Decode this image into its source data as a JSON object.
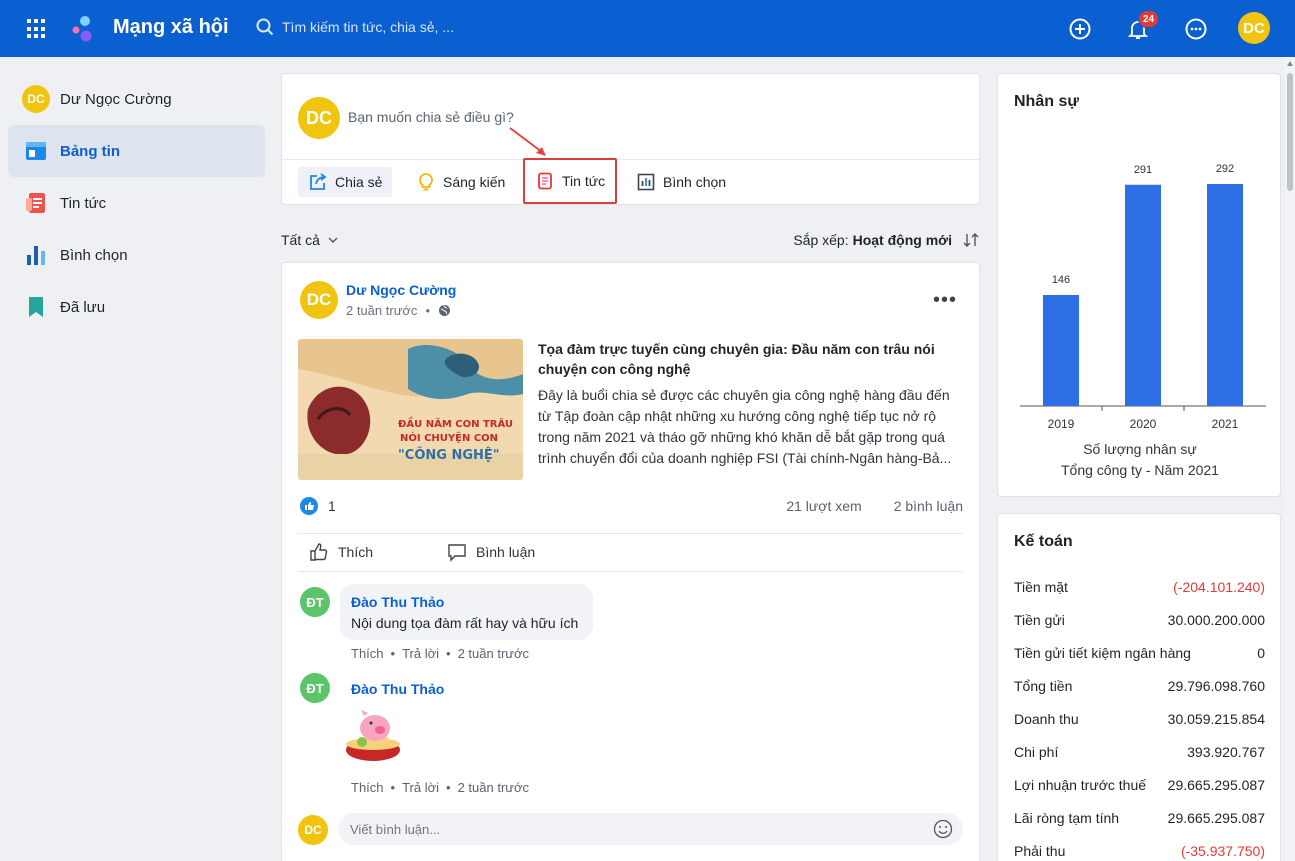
{
  "topbar": {
    "app_title": "Mạng xã hội",
    "search_placeholder": "Tìm kiếm tin tức, chia sẻ, ...",
    "notification_count": "24",
    "user_initials": "DC"
  },
  "sidebar": {
    "profile_name": "Dư Ngọc Cường",
    "profile_initials": "DC",
    "items": [
      {
        "label": "Bảng tin",
        "icon": "newsfeed-icon"
      },
      {
        "label": "Tin tức",
        "icon": "news-icon"
      },
      {
        "label": "Bình chọn",
        "icon": "poll-icon"
      },
      {
        "label": "Đã lưu",
        "icon": "bookmark-icon"
      }
    ]
  },
  "composer": {
    "initials": "DC",
    "prompt": "Bạn muốn chia sẻ điều gì?",
    "actions": [
      "Chia sẻ",
      "Sáng kiến",
      "Tin tức",
      "Bình chọn"
    ]
  },
  "feed_filter": {
    "filter_label": "Tất cả",
    "sort_label": "Sắp xếp:",
    "sort_value": "Hoạt động mới"
  },
  "post": {
    "author": "Dư Ngọc Cường",
    "author_initials": "DC",
    "time": "2 tuần trước",
    "news_title": "Tọa đàm trực tuyến cùng chuyên gia: Đầu năm con trâu nói chuyện con công nghệ",
    "news_desc": "Đây là buổi chia sẻ được các chuyên gia công nghệ hàng đầu đến từ Tập đoàn cập nhật những xu hướng công nghệ tiếp tục nở rộ trong năm 2021 và tháo gỡ những khó khăn dễ bắt gặp trong quá trình chuyển đổi của doanh nghiệp FSI (Tài chính-Ngân hàng-Bả...",
    "thumb_text_1": "ĐẦU NĂM CON TRÂU",
    "thumb_text_2": "NÓI CHUYỆN CON",
    "thumb_text_3": "\"CÔNG NGHỆ\"",
    "like_count": "1",
    "views": "21 lượt xem",
    "comments": "2 bình luận",
    "like_label": "Thích",
    "comment_label": "Bình luận",
    "comment_placeholder": "Viết bình luận...",
    "commenter_initials": "DC"
  },
  "comments": [
    {
      "initials": "ĐT",
      "name": "Đào Thu Thảo",
      "text": "Nội dung tọa đàm rất hay và hữu ích",
      "like": "Thích",
      "reply": "Trả lời",
      "time": "2 tuần trước"
    },
    {
      "initials": "ĐT",
      "name": "Đào Thu Thảo",
      "text": "",
      "like": "Thích",
      "reply": "Trả lời",
      "time": "2 tuần trước"
    }
  ],
  "hr_widget": {
    "title": "Nhân sự",
    "caption_line1": "Số lượng nhân sự",
    "caption_line2": "Tổng công ty - Năm 2021"
  },
  "chart_data": {
    "type": "bar",
    "categories": [
      "2019",
      "2020",
      "2021"
    ],
    "values": [
      146,
      291,
      292
    ],
    "title": "Số lượng nhân sự",
    "subtitle": "Tổng công ty - Năm 2021",
    "ylim": [
      0,
      292
    ],
    "grid": false,
    "color": "#2f6fe6"
  },
  "accounting": {
    "title": "Kế toán",
    "rows": [
      {
        "label": "Tiền mặt",
        "value": "(-204.101.240)",
        "negative": true
      },
      {
        "label": "Tiền gửi",
        "value": "30.000.200.000",
        "negative": false
      },
      {
        "label": "Tiền gửi tiết kiệm ngân hàng",
        "value": "0",
        "negative": false
      },
      {
        "label": "Tổng tiền",
        "value": "29.796.098.760",
        "negative": false
      },
      {
        "label": "Doanh thu",
        "value": "30.059.215.854",
        "negative": false
      },
      {
        "label": "Chi phí",
        "value": "393.920.767",
        "negative": false
      },
      {
        "label": "Lợi nhuận trước thuế",
        "value": "29.665.295.087",
        "negative": false
      },
      {
        "label": "Lãi ròng tạm tính",
        "value": "29.665.295.087",
        "negative": false
      },
      {
        "label": "Phải thu",
        "value": "(-35.937.750)",
        "negative": true
      }
    ]
  },
  "colors": {
    "brand": "#0a5fd1",
    "avatar": "#f1c40f",
    "negative": "#e53935",
    "highlight_border": "#d9403a"
  }
}
